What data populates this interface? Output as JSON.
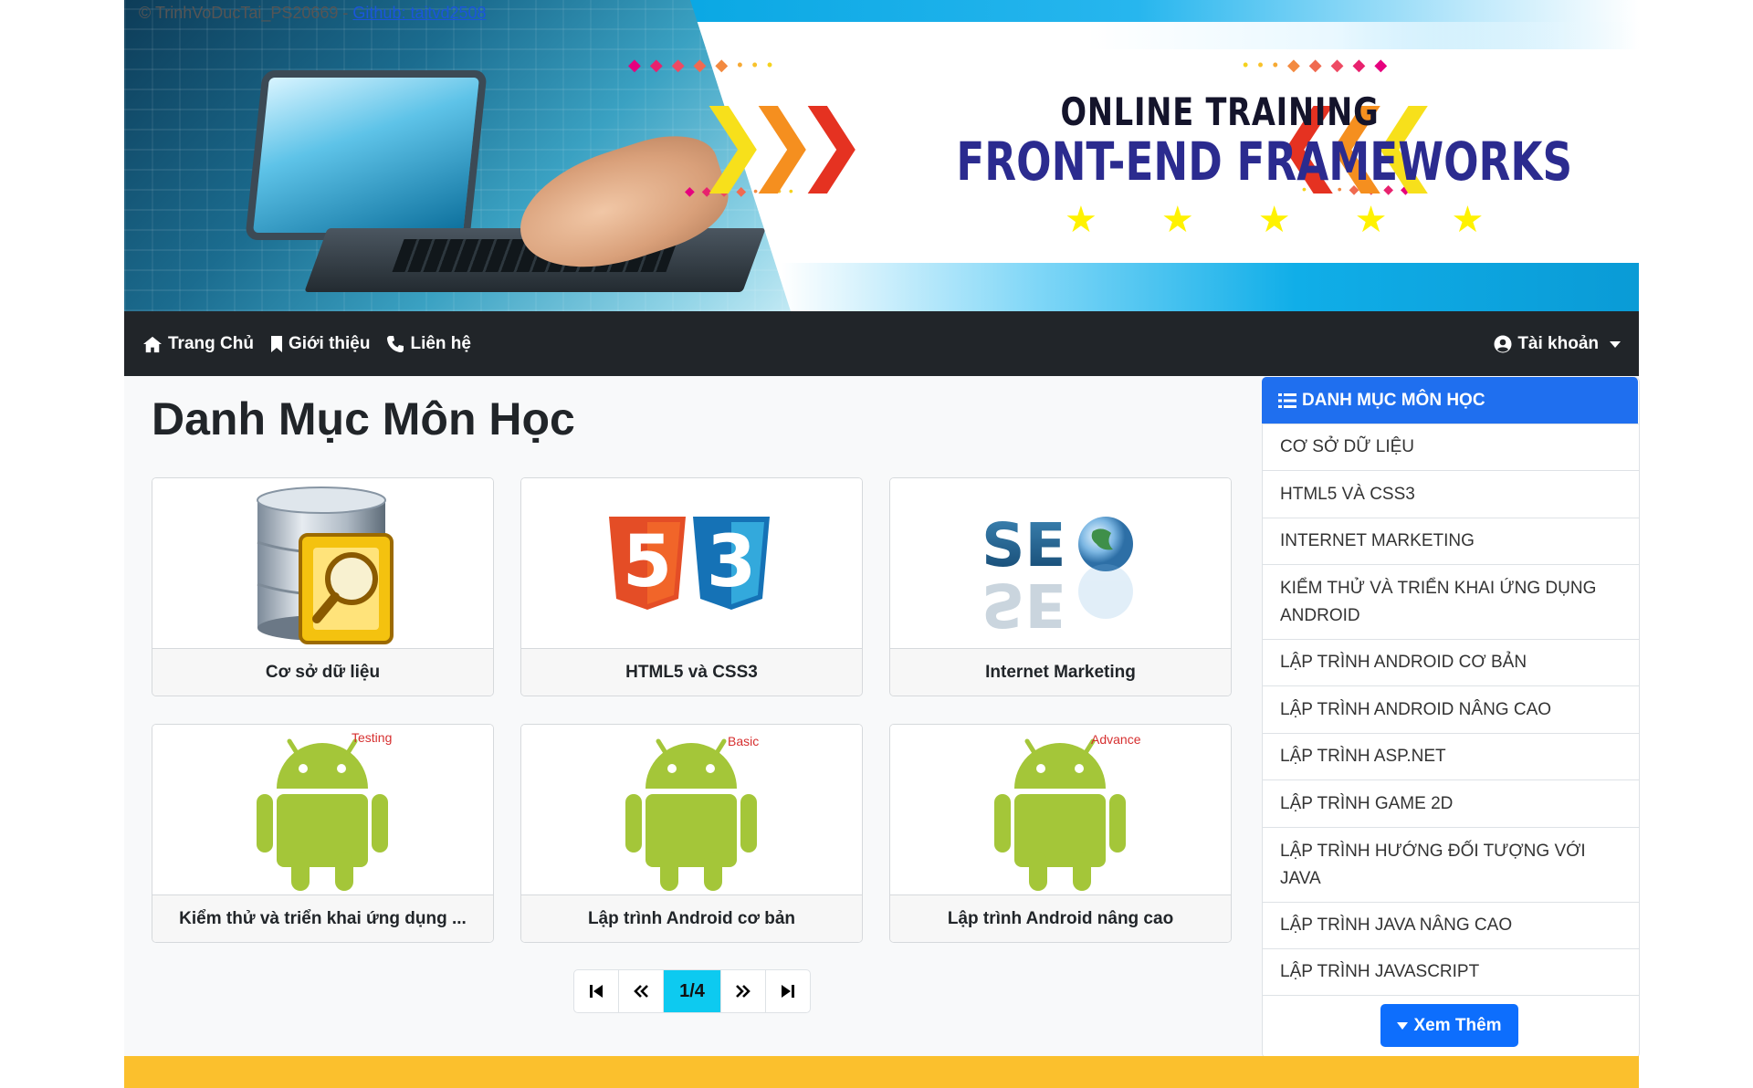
{
  "banner": {
    "copyright": "© TrinhVoDucTai_PS20669 -",
    "github_link": "Github: taitvd2508",
    "line1": "ONLINE TRAINING",
    "line2": "FRONT-END FRAMEWORKS"
  },
  "navbar": {
    "home": "Trang Chủ",
    "about": "Giới thiệu",
    "contact": "Liên hệ",
    "account": "Tài khoản"
  },
  "main": {
    "title": "Danh Mục Môn Học",
    "cards": [
      {
        "label": "Cơ sở dữ liệu",
        "icon": "database-search-icon"
      },
      {
        "label": "HTML5 và CSS3",
        "icon": "html5-css3-logo"
      },
      {
        "label": "Internet Marketing",
        "icon": "seo-globe-icon"
      },
      {
        "label": "Kiểm thử và triển khai ứng dụng ...",
        "icon": "android-icon",
        "tag": "Testing"
      },
      {
        "label": "Lập trình Android cơ bản",
        "icon": "android-icon",
        "tag": "Basic"
      },
      {
        "label": "Lập trình Android nâng cao",
        "icon": "android-icon",
        "tag": "Advance"
      }
    ],
    "pager": {
      "current": "1/4"
    }
  },
  "sidebar": {
    "title": "DANH MỤC MÔN HỌC",
    "items": [
      "CƠ SỞ DỮ LIỆU",
      "HTML5 VÀ CSS3",
      "INTERNET MARKETING",
      "KIỂM THỬ VÀ TRIỂN KHAI ỨNG DỤNG ANDROID",
      "LẬP TRÌNH ANDROID CƠ BẢN",
      "LẬP TRÌNH ANDROID NÂNG CAO",
      "LẬP TRÌNH ASP.NET",
      "LẬP TRÌNH GAME 2D",
      "LẬP TRÌNH HƯỚNG ĐỐI TƯỢNG VỚI JAVA",
      "LẬP TRÌNH JAVA NÂNG CAO",
      "LẬP TRÌNH JAVASCRIPT"
    ],
    "more_button": "Xem Thêm"
  },
  "colors": {
    "navbar": "#212529",
    "sidebar_header": "#1f6fef",
    "pager_active": "#0dcaf0",
    "more_button": "#0d6efd",
    "footer": "#fbc02d",
    "android_green": "#a4c639"
  }
}
